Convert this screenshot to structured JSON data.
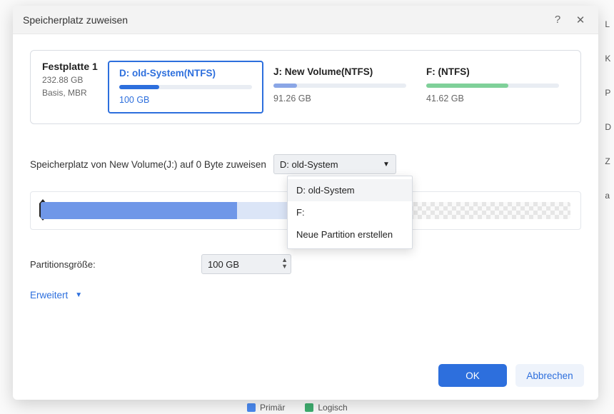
{
  "dialog": {
    "title": "Speicherplatz zuweisen",
    "help_icon": "?",
    "close_icon": "✕"
  },
  "disk": {
    "name": "Festplatte 1",
    "total": "232.88 GB",
    "type": "Basis, MBR"
  },
  "partitions": [
    {
      "label": "D: old-System(NTFS)",
      "size": "100 GB",
      "bar_color": "#2d6fdd",
      "fill_pct": 30,
      "selected": true
    },
    {
      "label": "J: New Volume(NTFS)",
      "size": "91.26 GB",
      "bar_color": "#8aa6e6",
      "fill_pct": 18,
      "selected": false
    },
    {
      "label": "F: (NTFS)",
      "size": "41.62 GB",
      "bar_color": "#7fd099",
      "fill_pct": 62,
      "selected": false
    }
  ],
  "assign": {
    "sentence": "Speicherplatz von New Volume(J:) auf 0 Byte zuweisen",
    "selected": "D: old-System",
    "options": [
      "D: old-System",
      "F:",
      "Neue Partition erstellen"
    ]
  },
  "size": {
    "label": "Partitionsgröße:",
    "value": "100 GB"
  },
  "advanced": "Erweitert",
  "buttons": {
    "ok": "OK",
    "cancel": "Abbrechen"
  },
  "legend": {
    "primary": "Primär",
    "logical": "Logisch",
    "primary_color": "#4b8af0",
    "logical_color": "#3fae70"
  },
  "side_letters": [
    "L",
    "K",
    "P",
    "D",
    "Z",
    "a"
  ]
}
